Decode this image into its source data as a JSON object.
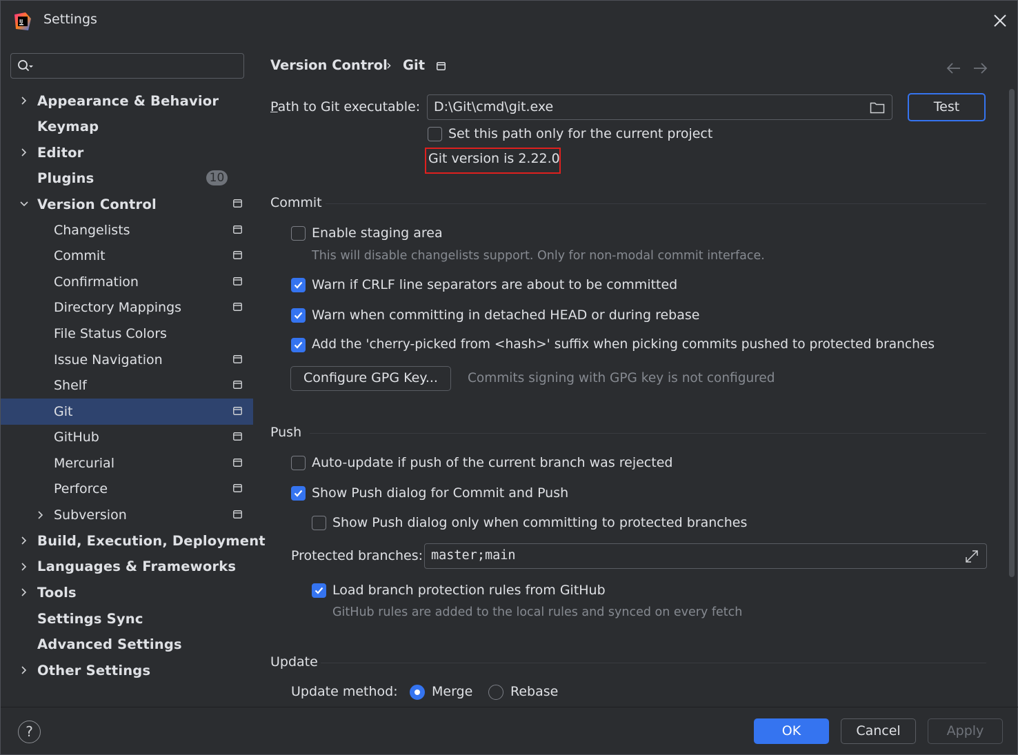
{
  "window": {
    "title": "Settings",
    "app_icon": "intellij-logo-icon",
    "close_icon": "close-icon"
  },
  "sidebar": {
    "search_placeholder": "",
    "items": [
      {
        "label": "Appearance & Behavior",
        "level": "top",
        "expandable": true,
        "expanded": false
      },
      {
        "label": "Keymap",
        "level": "top",
        "expandable": false
      },
      {
        "label": "Editor",
        "level": "top",
        "expandable": true,
        "expanded": false
      },
      {
        "label": "Plugins",
        "level": "top",
        "expandable": false,
        "badge": "10"
      },
      {
        "label": "Version Control",
        "level": "top",
        "expandable": true,
        "expanded": true,
        "project_icon": true
      },
      {
        "label": "Changelists",
        "level": "sub",
        "project_icon": true
      },
      {
        "label": "Commit",
        "level": "sub",
        "project_icon": true
      },
      {
        "label": "Confirmation",
        "level": "sub",
        "project_icon": true
      },
      {
        "label": "Directory Mappings",
        "level": "sub",
        "project_icon": true
      },
      {
        "label": "File Status Colors",
        "level": "sub",
        "project_icon": false
      },
      {
        "label": "Issue Navigation",
        "level": "sub",
        "project_icon": true
      },
      {
        "label": "Shelf",
        "level": "sub",
        "project_icon": true
      },
      {
        "label": "Git",
        "level": "sub",
        "project_icon": true,
        "selected": true
      },
      {
        "label": "GitHub",
        "level": "sub",
        "project_icon": true
      },
      {
        "label": "Mercurial",
        "level": "sub",
        "project_icon": true
      },
      {
        "label": "Perforce",
        "level": "sub",
        "project_icon": true
      },
      {
        "label": "Subversion",
        "level": "sub",
        "expandable": true,
        "project_icon": true
      },
      {
        "label": "Build, Execution, Deployment",
        "level": "top",
        "expandable": true
      },
      {
        "label": "Languages & Frameworks",
        "level": "top",
        "expandable": true
      },
      {
        "label": "Tools",
        "level": "top",
        "expandable": true
      },
      {
        "label": "Settings Sync",
        "level": "top",
        "expandable": false
      },
      {
        "label": "Advanced Settings",
        "level": "top",
        "expandable": false
      },
      {
        "label": "Other Settings",
        "level": "top",
        "expandable": true
      }
    ]
  },
  "breadcrumb": {
    "parent": "Version Control",
    "separator": "›",
    "current": "Git"
  },
  "git_path": {
    "label_prefix": "P",
    "label_rest": "ath to Git executable:",
    "value": "D:\\Git\\cmd\\git.exe",
    "browse_icon": "folder-icon",
    "test_button": "Test",
    "project_only_label": "Set this path only for the current project",
    "project_only_checked": false,
    "version_text": "Git version is 2.22.0"
  },
  "commit": {
    "section_title": "Commit",
    "staging_label": "Enable staging area",
    "staging_checked": false,
    "staging_hint": "This will disable changelists support. Only for non-modal commit interface.",
    "crlf_label": "Warn if CRLF line separators are about to be committed",
    "crlf_checked": true,
    "detached_label": "Warn when committing in detached HEAD or during rebase",
    "detached_checked": true,
    "cherry_label": "Add the 'cherry-picked from <hash>' suffix when picking commits pushed to protected branches",
    "cherry_checked": true,
    "gpg_button": "Configure GPG Key...",
    "gpg_hint": "Commits signing with GPG key is not configured"
  },
  "push": {
    "section_title": "Push",
    "autoupdate_label": "Auto-update if push of the current branch was rejected",
    "autoupdate_checked": false,
    "show_dialog_label": "Show Push dialog for Commit and Push",
    "show_dialog_checked": true,
    "protected_only_label": "Show Push dialog only when committing to protected branches",
    "protected_only_checked": false,
    "protected_label": "Protected branches:",
    "protected_value": "master;main",
    "github_rules_label": "Load branch protection rules from GitHub",
    "github_rules_checked": true,
    "github_rules_hint": "GitHub rules are added to the local rules and synced on every fetch"
  },
  "update": {
    "section_title": "Update",
    "method_label": "Update method:",
    "options": [
      "Merge",
      "Rebase"
    ],
    "selected": "Merge"
  },
  "footer": {
    "help": "?",
    "ok": "OK",
    "cancel": "Cancel",
    "apply": "Apply"
  },
  "colors": {
    "accent": "#3574f0",
    "selected_row": "#2e436e",
    "highlight_box": "#e0201e",
    "background": "#2b2d30"
  }
}
